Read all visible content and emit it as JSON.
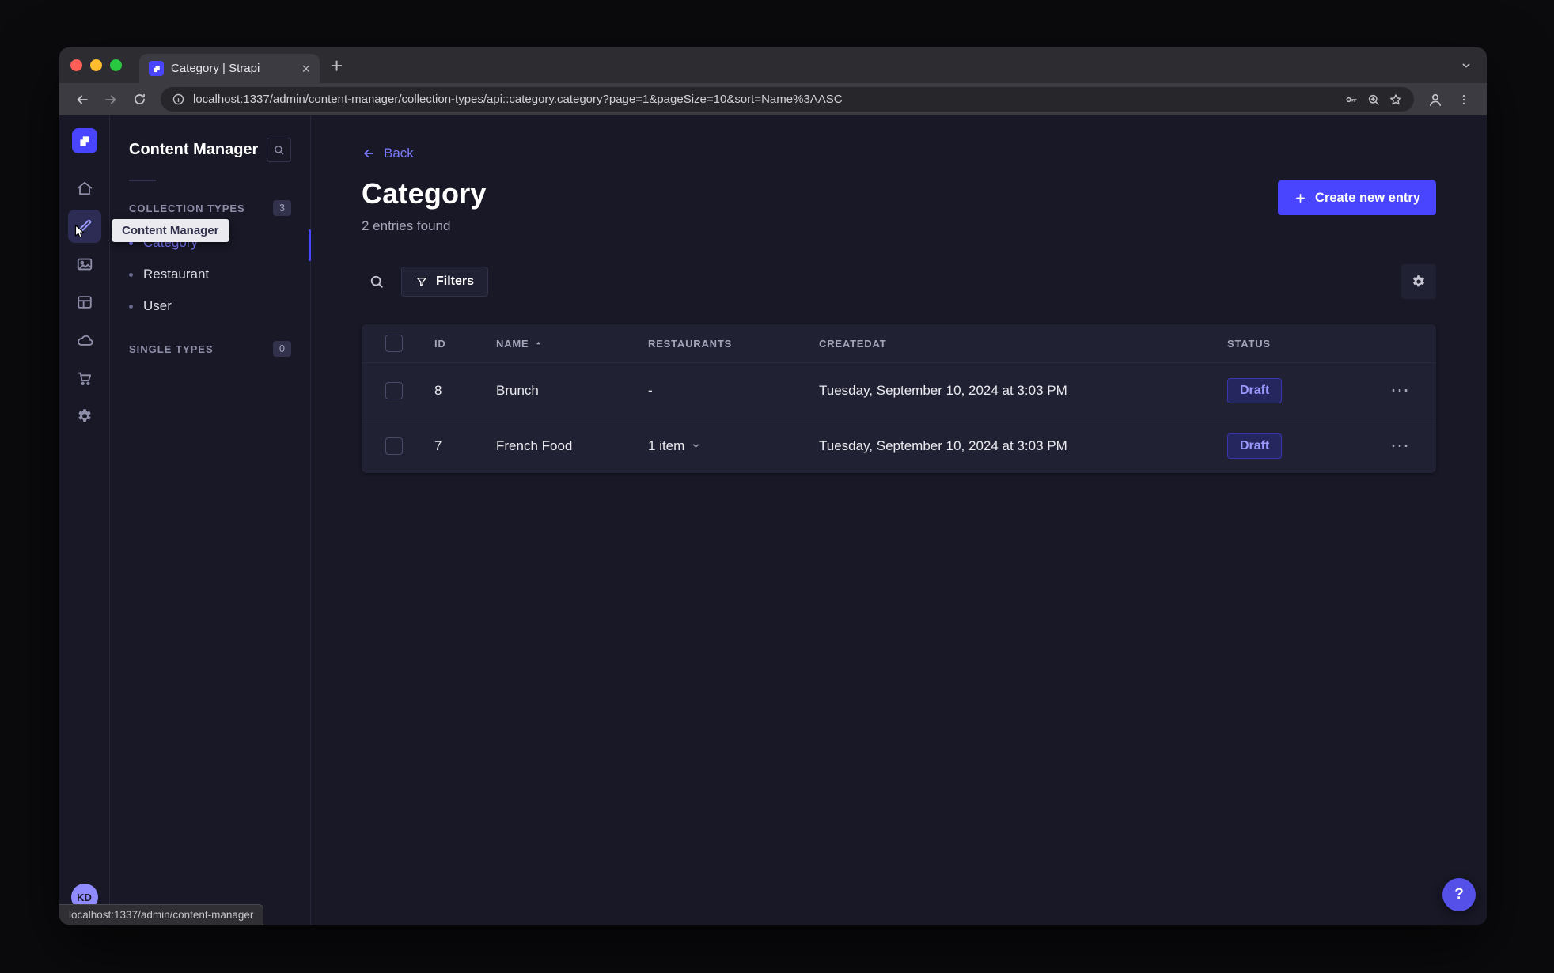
{
  "browser": {
    "tab_title": "Category | Strapi",
    "url": "localhost:1337/admin/content-manager/collection-types/api::category.category?page=1&pageSize=10&sort=Name%3AASC",
    "status_link": "localhost:1337/admin/content-manager"
  },
  "app": {
    "tooltip": "Content Manager",
    "avatar_initials": "KD"
  },
  "sidebar": {
    "title": "Content Manager",
    "collection_types": {
      "label": "COLLECTION TYPES",
      "count": "3"
    },
    "single_types": {
      "label": "SINGLE TYPES",
      "count": "0"
    },
    "items": [
      {
        "label": "Category",
        "active": true
      },
      {
        "label": "Restaurant",
        "active": false
      },
      {
        "label": "User",
        "active": false
      }
    ]
  },
  "main": {
    "back_label": "Back",
    "title": "Category",
    "subtitle": "2 entries found",
    "create_button": "Create new entry",
    "filters_button": "Filters",
    "table": {
      "headers": {
        "id": "ID",
        "name": "NAME",
        "restaurants": "RESTAURANTS",
        "created": "CREATEDAT",
        "status": "STATUS"
      },
      "rows": [
        {
          "id": "8",
          "name": "Brunch",
          "restaurants": "-",
          "created": "Tuesday, September 10, 2024 at 3:03 PM",
          "status": "Draft"
        },
        {
          "id": "7",
          "name": "French Food",
          "restaurants": "1 item",
          "created": "Tuesday, September 10, 2024 at 3:03 PM",
          "status": "Draft"
        }
      ]
    }
  },
  "icons": {
    "tab_close": "×",
    "new_tab": "+",
    "row_actions": "⋯",
    "help": "?"
  },
  "colors": {
    "accent": "#4945ff",
    "accent_light": "#7b79ff",
    "background": "#181826",
    "surface": "#212134",
    "traffic_red": "#ff5f57",
    "traffic_yellow": "#febc2e",
    "traffic_green": "#28c840"
  }
}
